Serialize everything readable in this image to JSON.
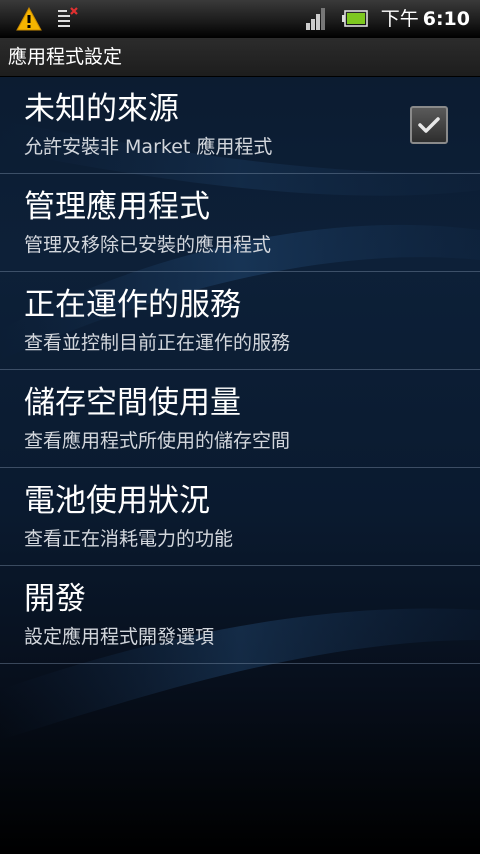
{
  "status_bar": {
    "ampm": "下午",
    "time": "6:10",
    "icons": [
      "warning-icon",
      "notification-icon",
      "signal-icon",
      "battery-icon"
    ]
  },
  "title_bar": {
    "title": "應用程式設定"
  },
  "settings": [
    {
      "label": "未知的來源",
      "summary": "允許安裝非 Market 應用程式",
      "has_checkbox": true,
      "checked": true
    },
    {
      "label": "管理應用程式",
      "summary": "管理及移除已安裝的應用程式"
    },
    {
      "label": "正在運作的服務",
      "summary": "查看並控制目前正在運作的服務"
    },
    {
      "label": "儲存空間使用量",
      "summary": "查看應用程式所使用的儲存空間"
    },
    {
      "label": "電池使用狀況",
      "summary": "查看正在消耗電力的功能"
    },
    {
      "label": "開發",
      "summary": "設定應用程式開發選項"
    }
  ],
  "colors": {
    "warning": "#f5b400",
    "battery": "#7ec820",
    "accent_text": "#ffffff"
  }
}
